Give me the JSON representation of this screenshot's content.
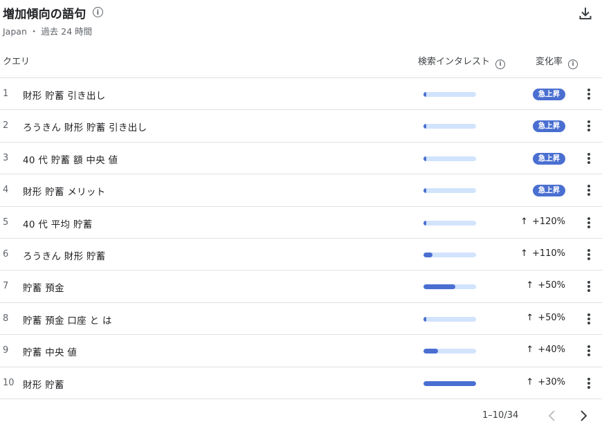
{
  "header": {
    "title": "増加傾向の語句",
    "info_icon": "i",
    "subtitle": "Japan ・ 過去 24 時間",
    "download_icon": "download-icon"
  },
  "columns": {
    "query": "クエリ",
    "interest": "検索インタレスト",
    "change": "変化率",
    "info_icon": "i"
  },
  "colors": {
    "accent": "#4a6fd1",
    "bar_track": "#d2e3fc"
  },
  "rows": [
    {
      "index": "1",
      "query": "財形 貯蓄 引き出し",
      "interest": 0.05,
      "change": "急上昇",
      "badge": true
    },
    {
      "index": "2",
      "query": "ろうきん 財形 貯蓄 引き出し",
      "interest": 0.05,
      "change": "急上昇",
      "badge": true
    },
    {
      "index": "3",
      "query": "40 代 貯蓄 額 中央 値",
      "interest": 0.03,
      "change": "急上昇",
      "badge": true
    },
    {
      "index": "4",
      "query": "財形 貯蓄 メリット",
      "interest": 0.03,
      "change": "急上昇",
      "badge": true
    },
    {
      "index": "5",
      "query": "40 代 平均 貯蓄",
      "interest": 0.05,
      "change": "+120%",
      "arrow": "↑",
      "badge": false
    },
    {
      "index": "6",
      "query": "ろうきん 財形 貯蓄",
      "interest": 0.17,
      "change": "+110%",
      "arrow": "↑",
      "badge": false
    },
    {
      "index": "7",
      "query": "貯蓄 預金",
      "interest": 0.6,
      "change": "+50%",
      "arrow": "↑",
      "badge": false
    },
    {
      "index": "8",
      "query": "貯蓄 預金 口座 と は",
      "interest": 0.03,
      "change": "+50%",
      "arrow": "↑",
      "badge": false
    },
    {
      "index": "9",
      "query": "貯蓄 中央 値",
      "interest": 0.27,
      "change": "+40%",
      "arrow": "↑",
      "badge": false
    },
    {
      "index": "10",
      "query": "財形 貯蓄",
      "interest": 1.0,
      "change": "+30%",
      "arrow": "↑",
      "badge": false
    }
  ],
  "pagination": {
    "label": "1–10/34"
  }
}
